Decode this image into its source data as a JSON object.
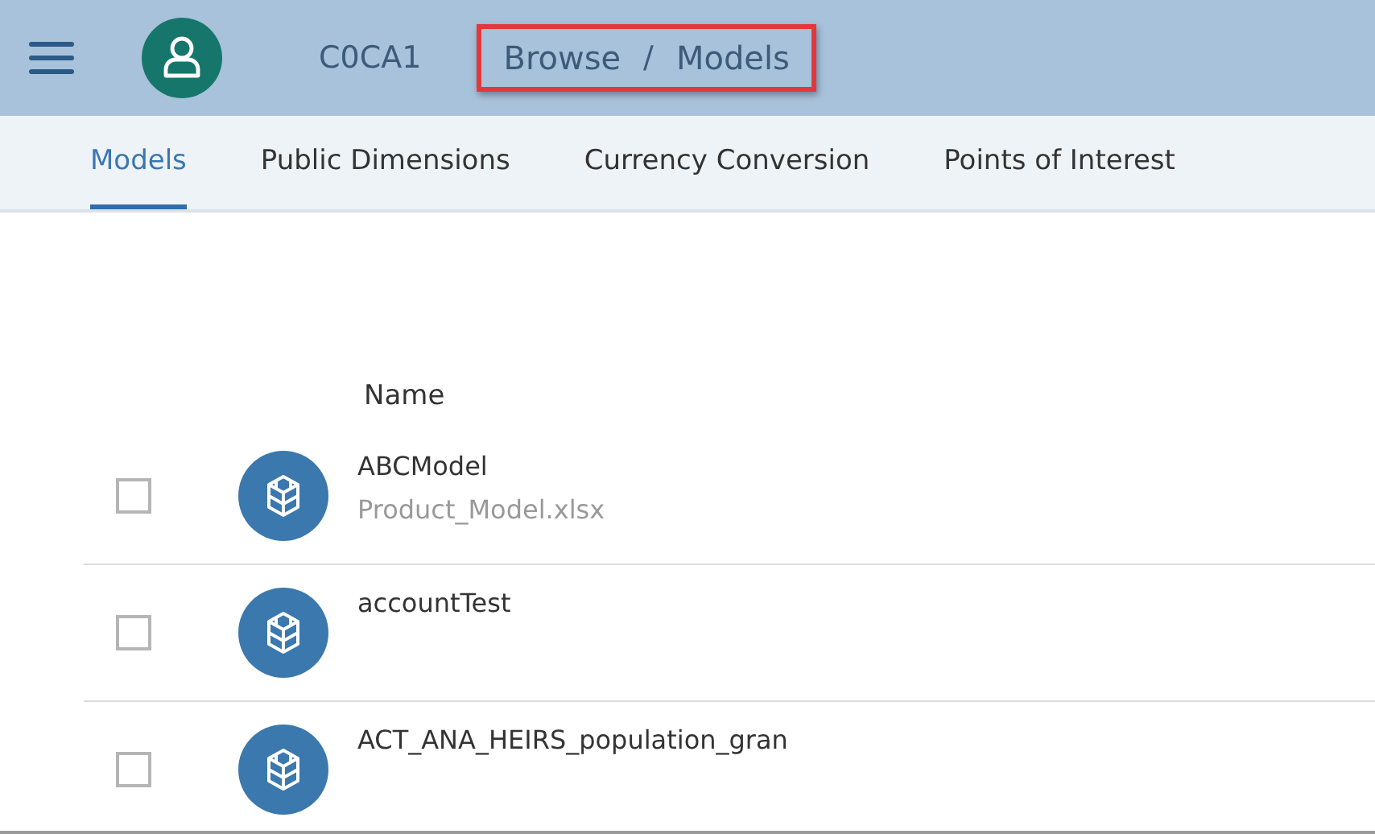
{
  "header": {
    "tenant": "C0CA1",
    "breadcrumb": [
      {
        "label": "Browse"
      },
      {
        "label": "Models"
      }
    ],
    "breadcrumb_separator": "/",
    "breadcrumb_highlighted": true
  },
  "tabs": [
    {
      "label": "Models",
      "selected": true
    },
    {
      "label": "Public Dimensions",
      "selected": false
    },
    {
      "label": "Currency Conversion",
      "selected": false
    },
    {
      "label": "Points of Interest",
      "selected": false
    }
  ],
  "table": {
    "columns": [
      "Name"
    ],
    "rows": [
      {
        "name": "ABCModel",
        "source": "Product_Model.xlsx",
        "checked": false
      },
      {
        "name": "accountTest",
        "checked": false
      },
      {
        "name": "ACT_ANA_HEIRS_population_gran",
        "checked": false
      }
    ]
  }
}
